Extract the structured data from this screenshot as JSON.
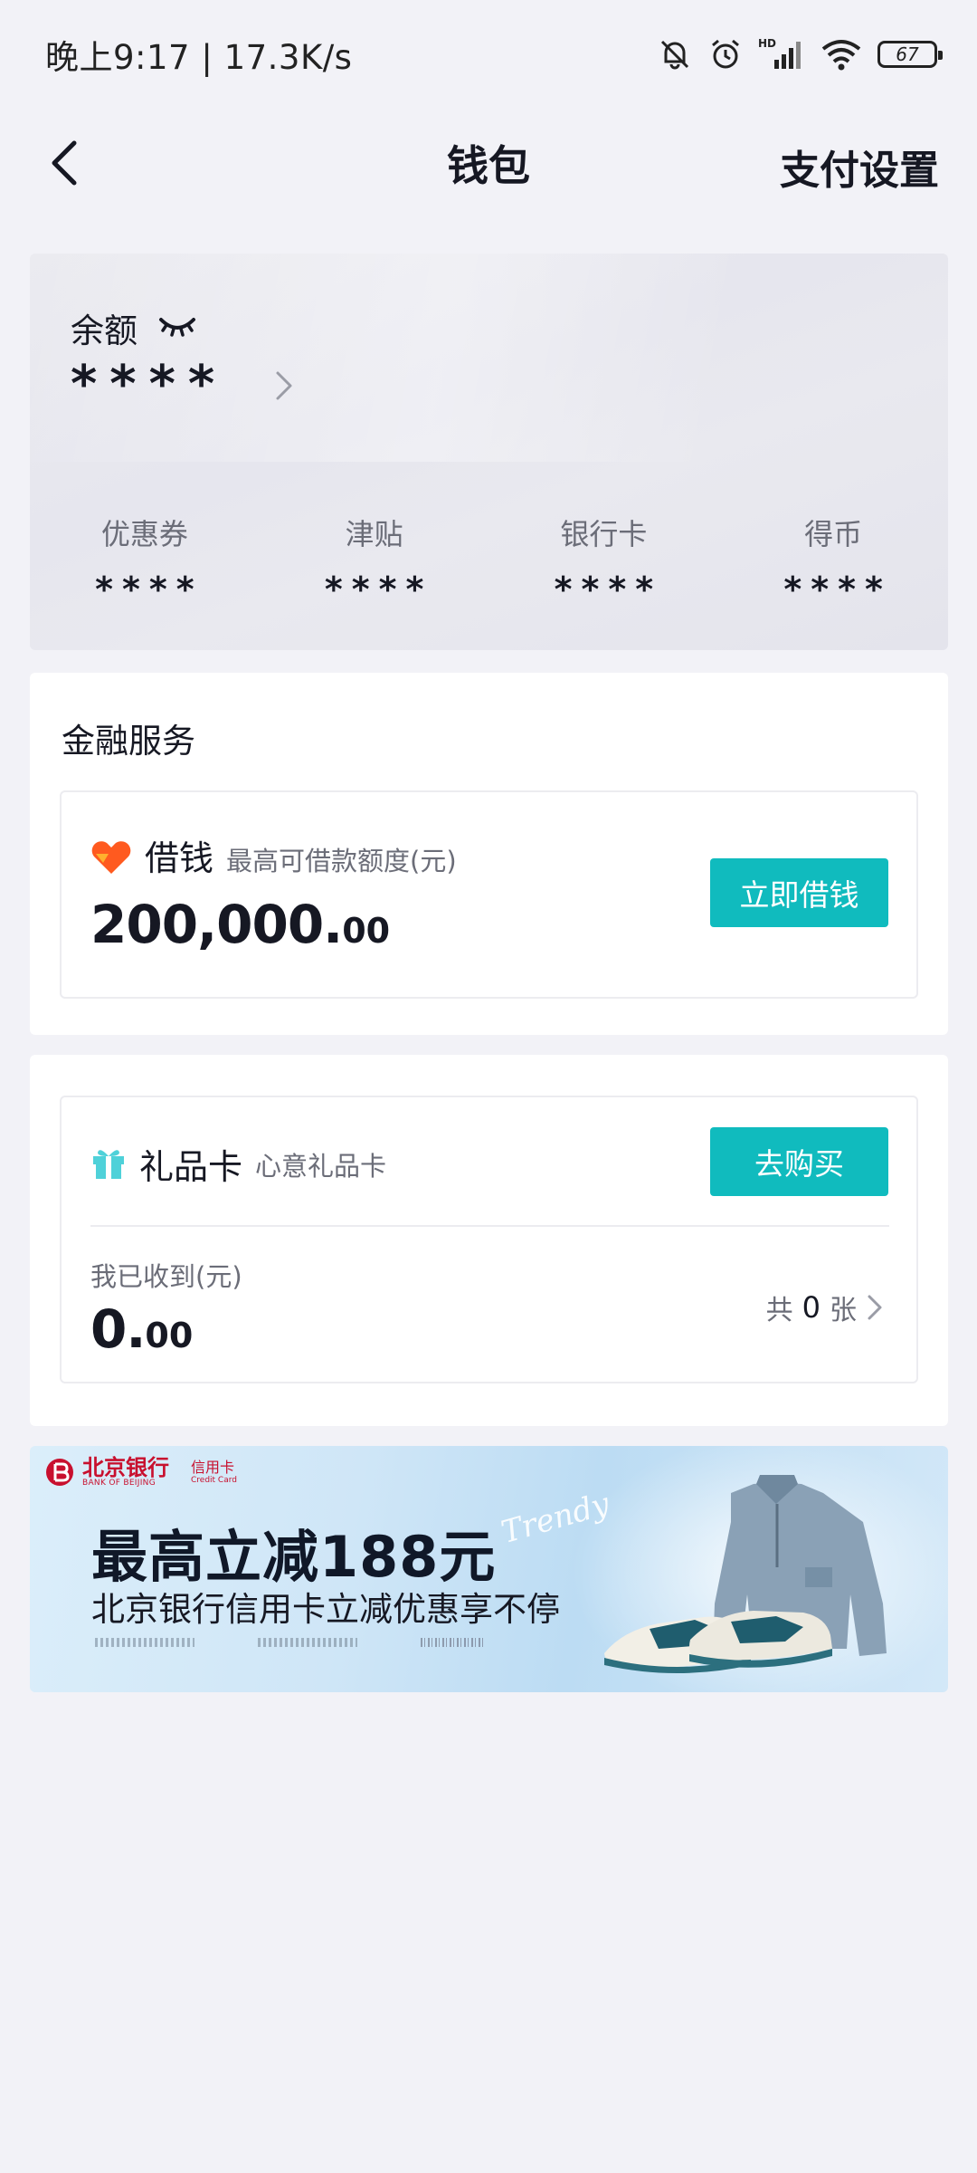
{
  "status_bar": {
    "time_speed": "晚上9:17 | 17.3K/s",
    "battery": "67",
    "network_tag": "HD"
  },
  "nav": {
    "title": "钱包",
    "action": "支付设置"
  },
  "balance": {
    "label": "余额",
    "value": "****",
    "assets": [
      {
        "label": "优惠券",
        "value": "****"
      },
      {
        "label": "津贴",
        "value": "****"
      },
      {
        "label": "银行卡",
        "value": "****"
      },
      {
        "label": "得币",
        "value": "****"
      }
    ]
  },
  "finance": {
    "title": "金融服务",
    "loan": {
      "name": "借钱",
      "subtitle": "最高可借款额度(元)",
      "amount_int": "200,000.",
      "amount_dec": "00",
      "button": "立即借钱"
    }
  },
  "gift_card": {
    "name": "礼品卡",
    "subtitle": "心意礼品卡",
    "button": "去购买",
    "received_label": "我已收到(元)",
    "amount_int": "0.",
    "amount_dec": "00",
    "count_prefix": "共",
    "count": "0",
    "count_suffix": "张"
  },
  "banner": {
    "bank_name_cn": "北京银行",
    "bank_name_en": "BANK OF BEIJING",
    "bank_tag_cn": "信用卡",
    "bank_tag_en": "Credit Card",
    "title": "最高立减188元",
    "script_text": "Trendy",
    "subtitle": "北京银行信用卡立减优惠享不停"
  },
  "colors": {
    "accent": "#10bbbe",
    "page_bg": "#f2f2f7",
    "loan_icon": "#ff5a1f",
    "gift_icon": "#4fd1d9",
    "bank_red": "#c8102e"
  }
}
